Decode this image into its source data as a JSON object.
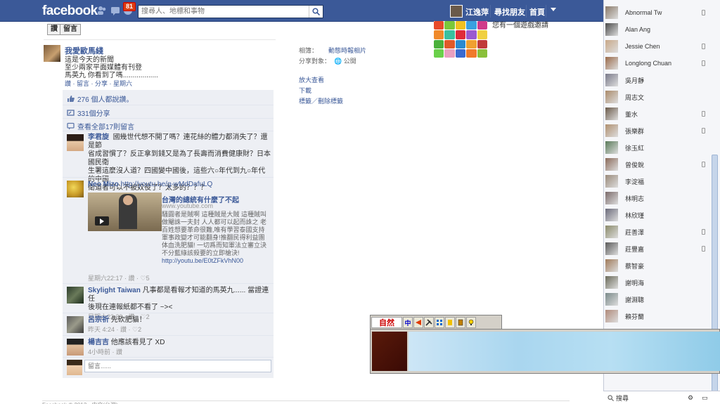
{
  "topbar": {
    "logo": "facebook",
    "notif_count": "81",
    "search_placeholder": "搜尋人、地標和事物",
    "user_name": "江逸萍",
    "find_friends": "尋找朋友",
    "home": "首頁"
  },
  "photo_actions": {
    "like": "讚",
    "comment": "留言"
  },
  "post": {
    "author": "我愛歐馬綫",
    "line1": "這是今天的新聞",
    "line2": "至少兩家平面媒體有刊登",
    "line3": "馬英九  你看到了嗎..................",
    "actions": "讚 · 留言 · 分享 · 星期六"
  },
  "photo_meta": {
    "album_label": "相簿：",
    "album_value": "動態時報相片",
    "share_label": "分享對象：",
    "share_value": "公開",
    "view_full": "放大查看",
    "download": "下載",
    "tag_remove": "標籤／刪除標籤"
  },
  "ufi": {
    "likes": "276 個人都說讚。",
    "shares": "331個分享",
    "view_all": "查看全部17則留言",
    "comment_placeholder": "留言......"
  },
  "comments": [
    {
      "author": "李君旋",
      "text1": "國幾世代想不開了嗎？連花絲的體力都消失了？還是節",
      "text2": "省成習慣了？反正拿到錢又是為了長壽而消費健康財？日本國民衛",
      "text3": "生署這麼沒人道？四國變中國後，這些六○年代到九○年代的中國",
      "text4": "衛道者可以不被奴役了？太多的？？？",
      "meta": "星期六22:16 · 讚"
    },
    {
      "author": "Neo Mizo",
      "link": "http://youtu.be/g-wMdDafuLQ",
      "yt_title": "台灣的總統有什麼了不起",
      "yt_site": "www.youtube.com",
      "yt_desc": "騷圓者是賊啊 這種賊是大賊 這種賊叫做閹誅一夫封 人人都可以起而誅之 老百姓想要革命很難,唯有學習泰國支持軍事政變才可能翻身!推翻民得利益團体血洗肥貓! 一切爲而知軍法立審立決不分藍綠該殺要的立即槍決!",
      "yt_url": "http://youtu.be/E0tZFkVhN00",
      "meta": "星期六22:17 · 讚 · ♡5"
    },
    {
      "author": "Skylight Taiwan",
      "text1": "凡事都是看報才知道的馬英九...... 當證連任",
      "text2": "後現在連報紙都不看了 ~><",
      "meta": "星期六23:39 · 讚 · ♡2"
    },
    {
      "author": "呂宗祈",
      "text1": "先砍肥貓！",
      "meta": "昨天 4:24 · 讚 · ♡2"
    },
    {
      "author": "楊吉吉",
      "text1": "他應該看見了 XD",
      "meta": "4小時前 · 讚"
    }
  ],
  "game": {
    "title": "您有一個遊戲邀請"
  },
  "chat": {
    "friends": [
      "Abnormal Tw",
      "Alan Ang",
      "Jessie Chen",
      "Longlong Chuan",
      "吳月靜",
      "周志文",
      "董水",
      "張樂群",
      "徐玉紅",
      "曾俊銳",
      "李淀福",
      "林明志",
      "林欣瑾",
      "莊善澤",
      "莊豐嘉",
      "蔡智豪",
      "謝明海",
      "謝淵聰",
      "賴芬蘭"
    ],
    "search_label": "搜尋"
  },
  "ime": {
    "logo": "自然",
    "mode": "中"
  },
  "footer": {
    "text": "Facebook © 2012 · 中文(台灣)"
  }
}
